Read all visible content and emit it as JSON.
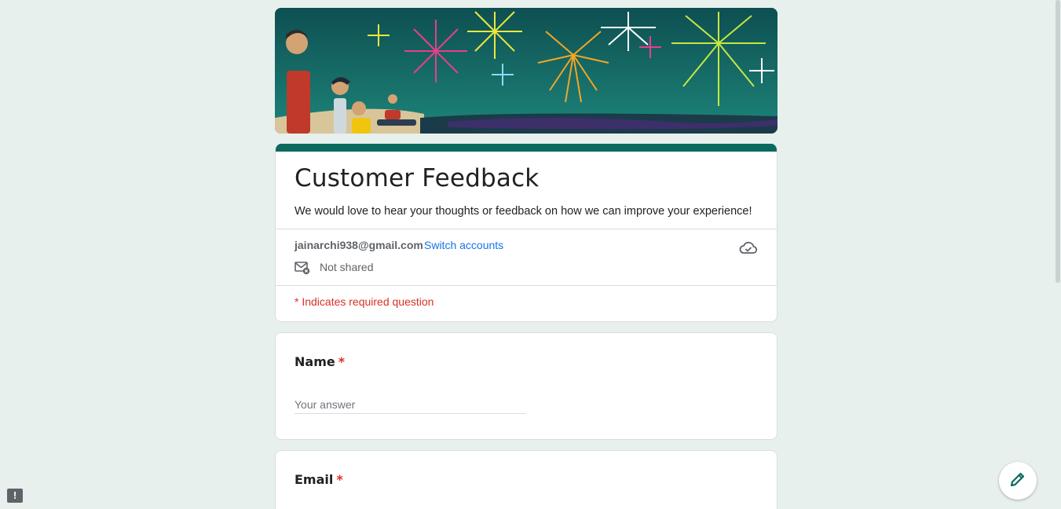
{
  "form": {
    "title": "Customer Feedback",
    "description": "We would love to hear your thoughts or feedback on how we can improve your experience!",
    "account_email": "jainarchi938@gmail.com",
    "switch_accounts": "Switch accounts",
    "sharing_status": "Not shared",
    "required_note": "* Indicates required question"
  },
  "questions": [
    {
      "label": "Name",
      "required_mark": "*",
      "placeholder": "Your answer"
    },
    {
      "label": "Email",
      "required_mark": "*"
    }
  ],
  "icons": {
    "mail_off": "mail-not-shared-icon",
    "cloud": "cloud-done-icon",
    "edit": "pencil-icon",
    "feedback": "report-feedback-icon"
  },
  "colors": {
    "theme": "#0b6a5f",
    "background": "#e8f0ee",
    "required": "#d93025",
    "link": "#1a73e8"
  }
}
